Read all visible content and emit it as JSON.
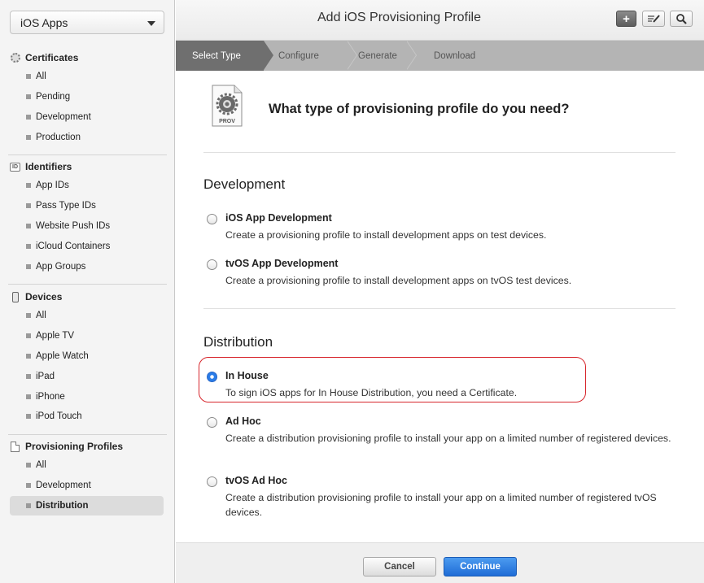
{
  "sidebar": {
    "platform_select": "iOS Apps",
    "sections": [
      {
        "title": "Certificates",
        "icon": "certificate-gear-icon",
        "items": [
          {
            "label": "All"
          },
          {
            "label": "Pending"
          },
          {
            "label": "Development"
          },
          {
            "label": "Production"
          }
        ]
      },
      {
        "title": "Identifiers",
        "icon": "id-badge-icon",
        "icon_text": "ID",
        "items": [
          {
            "label": "App IDs"
          },
          {
            "label": "Pass Type IDs"
          },
          {
            "label": "Website Push IDs"
          },
          {
            "label": "iCloud Containers"
          },
          {
            "label": "App Groups"
          }
        ]
      },
      {
        "title": "Devices",
        "icon": "phone-device-icon",
        "items": [
          {
            "label": "All"
          },
          {
            "label": "Apple TV"
          },
          {
            "label": "Apple Watch"
          },
          {
            "label": "iPad"
          },
          {
            "label": "iPhone"
          },
          {
            "label": "iPod Touch"
          }
        ]
      },
      {
        "title": "Provisioning Profiles",
        "icon": "document-icon",
        "items": [
          {
            "label": "All"
          },
          {
            "label": "Development"
          },
          {
            "label": "Distribution",
            "active": true
          }
        ]
      }
    ]
  },
  "header": {
    "title": "Add iOS Provisioning Profile",
    "buttons": {
      "add": "+",
      "add_icon": "plus-icon",
      "edit_icon": "edit-icon",
      "search_icon": "search-icon"
    }
  },
  "steps": [
    "Select Type",
    "Configure",
    "Generate",
    "Download"
  ],
  "active_step": "Select Type",
  "main": {
    "icon_label": "PROV",
    "question": "What type of provisioning profile do you need?",
    "development": {
      "title": "Development",
      "options": [
        {
          "title": "iOS App Development",
          "description": "Create a provisioning profile to install development apps on test devices.",
          "checked": false
        },
        {
          "title": "tvOS App Development",
          "description": "Create a provisioning profile to install development apps on tvOS test devices.",
          "checked": false
        }
      ]
    },
    "distribution": {
      "title": "Distribution",
      "options": [
        {
          "title": "In House",
          "description": "To sign iOS apps for In House Distribution, you need a Certificate.",
          "checked": true
        },
        {
          "title": "Ad Hoc",
          "description": "Create a distribution provisioning profile to install your app on a limited number of registered devices.",
          "checked": false
        },
        {
          "title": "tvOS Ad Hoc",
          "description": "Create a distribution provisioning profile to install your app on a limited number of registered tvOS devices.",
          "checked": false
        }
      ]
    }
  },
  "footer": {
    "cancel_label": "Cancel",
    "continue_label": "Continue"
  },
  "colors": {
    "accent": "#1f6cd6",
    "highlight": "#d7262c",
    "step_active": "#6f6f6f",
    "step_bar": "#b4b4b4"
  }
}
